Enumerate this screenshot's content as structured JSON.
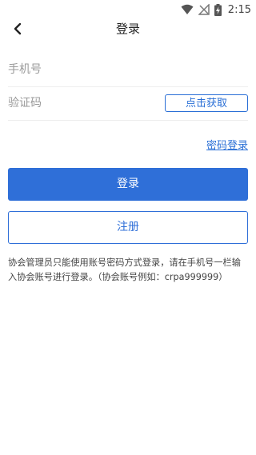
{
  "status_bar": {
    "time": "2:15",
    "icons": [
      "wifi-icon",
      "signal-icon",
      "battery-charging-icon"
    ]
  },
  "nav": {
    "back_icon": "chevron-left-icon",
    "title": "登录"
  },
  "form": {
    "phone_placeholder": "手机号",
    "code_placeholder": "验证码",
    "get_code_label": "点击获取",
    "password_login_link": "密码登录"
  },
  "actions": {
    "login_label": "登录",
    "register_label": "注册"
  },
  "notice": "协会管理员只能使用账号密码方式登录，请在手机号一栏输入协会账号进行登录。（协会账号例如：crpa999999）",
  "colors": {
    "primary": "#2f6fd8",
    "link": "#2a6fd6",
    "placeholder": "#9a9a9a",
    "divider": "#eeeeee"
  }
}
